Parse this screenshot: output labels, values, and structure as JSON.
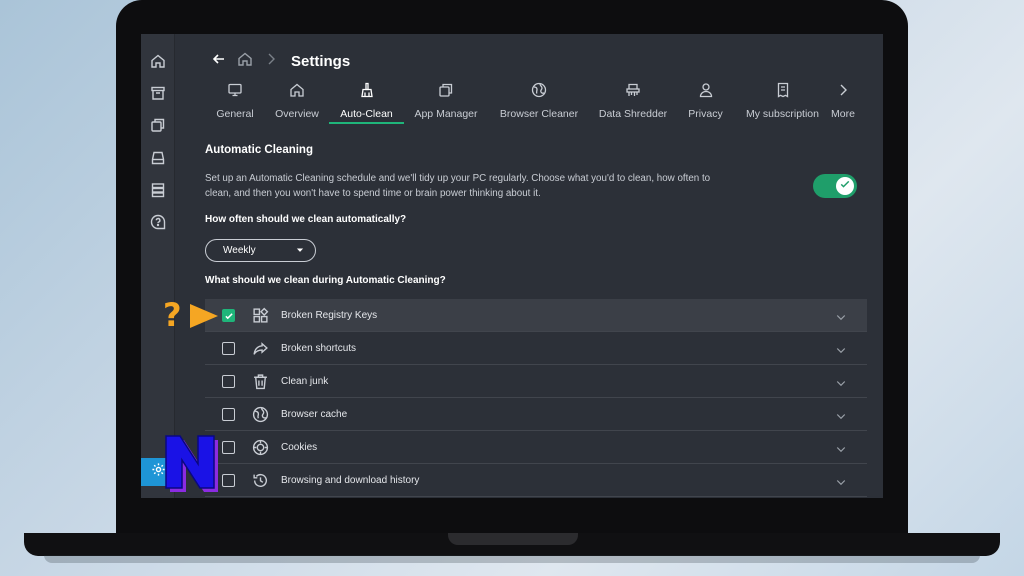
{
  "header": {
    "title": "Settings"
  },
  "tabs": [
    {
      "label": "General",
      "icon": "monitor-icon",
      "active": false
    },
    {
      "label": "Overview",
      "icon": "home-icon",
      "active": false
    },
    {
      "label": "Auto-Clean",
      "icon": "broom-icon",
      "active": true
    },
    {
      "label": "App Manager",
      "icon": "app-manager-icon",
      "active": false
    },
    {
      "label": "Browser Cleaner",
      "icon": "globe-icon",
      "active": false
    },
    {
      "label": "Data Shredder",
      "icon": "shredder-icon",
      "active": false
    },
    {
      "label": "Privacy",
      "icon": "user-icon",
      "active": false
    },
    {
      "label": "My subscription",
      "icon": "receipt-icon",
      "active": false
    },
    {
      "label": "More",
      "icon": "chevron-right-icon",
      "active": false
    }
  ],
  "auto_clean": {
    "title": "Automatic Cleaning",
    "description": "Set up an Automatic Cleaning schedule and we'll tidy up your PC regularly. Choose what you'd to clean, how often to clean, and then you won't have to spend time or brain power thinking about it.",
    "enabled": true,
    "frequency_question": "How often should we clean automatically?",
    "frequency_value": "Weekly",
    "items_question": "What should we clean during Automatic Cleaning?",
    "items": [
      {
        "label": "Broken Registry Keys",
        "checked": true,
        "icon": "grid-icon"
      },
      {
        "label": "Broken shortcuts",
        "checked": false,
        "icon": "shortcut-arrow-icon"
      },
      {
        "label": "Clean junk",
        "checked": false,
        "icon": "trash-icon"
      },
      {
        "label": "Browser cache",
        "checked": false,
        "icon": "globe-icon"
      },
      {
        "label": "Cookies",
        "checked": false,
        "icon": "cookie-icon"
      },
      {
        "label": "Browsing and download history",
        "checked": false,
        "icon": "history-icon"
      }
    ]
  },
  "overlay": {
    "question_mark": "?"
  },
  "colors": {
    "accent": "#1fb57a",
    "background": "#2c3038",
    "sidebar_active": "#1e95d6",
    "overlay_orange": "#f5a623"
  }
}
